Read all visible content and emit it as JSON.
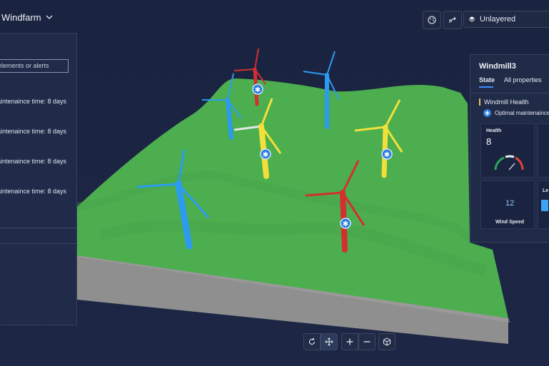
{
  "header": {
    "title": "Windfarm",
    "layer_label": "Unlayered"
  },
  "colors": {
    "background": "#1b2540",
    "terrain": "#4caf50",
    "turbine_blue": "#2b9bf0",
    "turbine_red": "#d32f2f",
    "turbine_yellow": "#f2e03a",
    "accent": "#3d8bff"
  },
  "left_panel": {
    "search_placeholder": "elements or alerts",
    "items": [
      {
        "text": "aintenaince time: 8 days"
      },
      {
        "text": "aintenaince time: 8 days"
      },
      {
        "text": "aintenaince time: 8 days"
      },
      {
        "text": "aintenaince time: 8 days"
      }
    ]
  },
  "right_panel": {
    "title": "Windmill3",
    "tabs": [
      {
        "label": "State",
        "active": true
      },
      {
        "label": "All properties",
        "active": false
      }
    ],
    "section_title": "Windmill Health",
    "maintenance_text": "Optimal maintenaince ti",
    "health_label": "Health",
    "health_value": "8",
    "wind_speed_value": "12",
    "wind_speed_label": "Wind Speed",
    "extra_label": "Le"
  },
  "icons": {
    "title_chevron": "chevron-down-icon",
    "palette": "palette-icon",
    "share": "share-icon",
    "layers": "layers-icon",
    "rotate": "rotate-icon",
    "pan": "pan-icon",
    "zoom_in": "plus-icon",
    "zoom_out": "minus-icon",
    "object": "cube-icon"
  }
}
